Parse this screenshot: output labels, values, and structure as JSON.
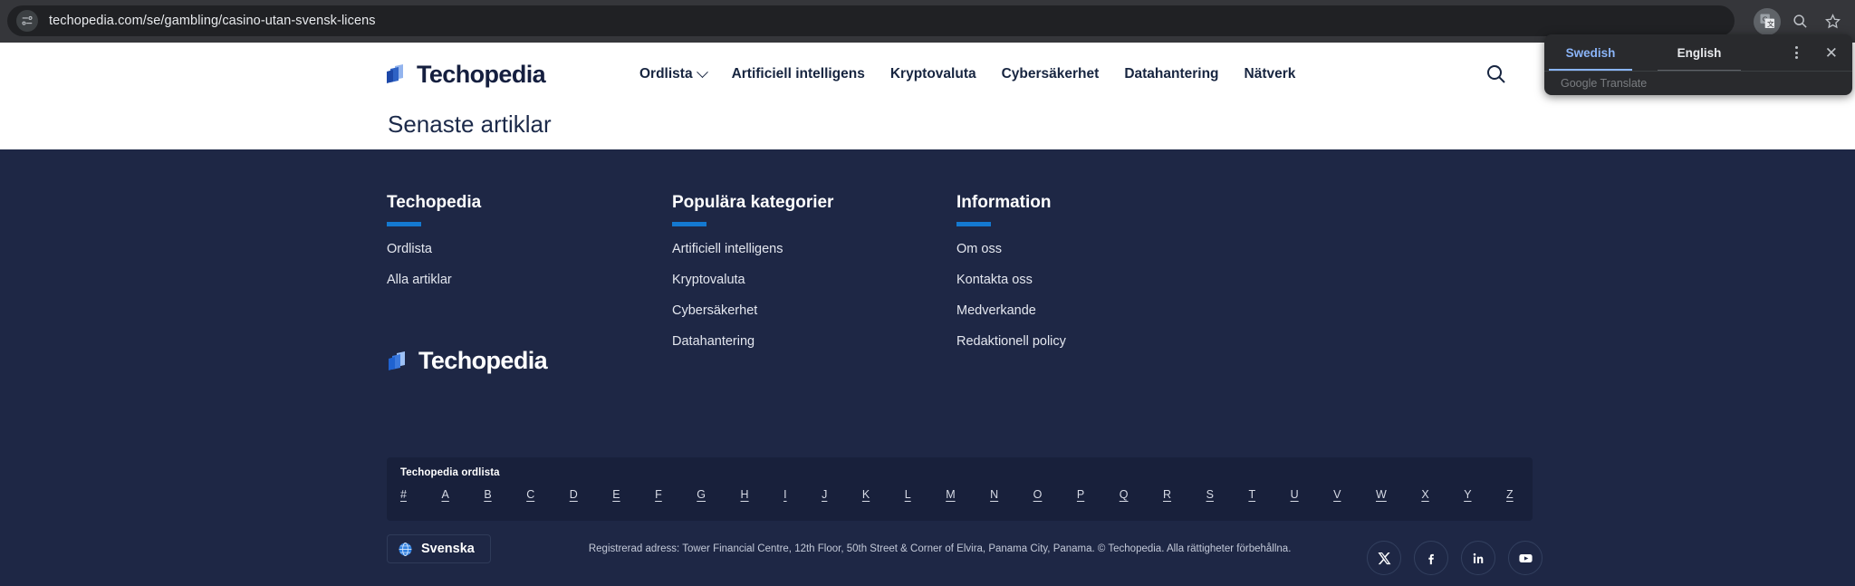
{
  "browser": {
    "url": "techopedia.com/se/gambling/casino-utan-svensk-licens",
    "page_info_icon": "page-settings-icon",
    "translate_icon": "google-translate-icon",
    "search_icon": "search-icon",
    "bookmark_icon": "bookmark-star-icon"
  },
  "translate_popup": {
    "source_lang": "Swedish",
    "target_lang": "English",
    "provider": "Google Translate",
    "menu_icon": "kebab-menu-icon",
    "close_icon": "close-icon",
    "accent": "#8ab4f8"
  },
  "header": {
    "brand": "Techopedia",
    "nav": [
      {
        "label": "Ordlista",
        "has_dropdown": true
      },
      {
        "label": "Artificiell intelligens",
        "has_dropdown": false
      },
      {
        "label": "Kryptovaluta",
        "has_dropdown": false
      },
      {
        "label": "Cybersäkerhet",
        "has_dropdown": false
      },
      {
        "label": "Datahantering",
        "has_dropdown": false
      },
      {
        "label": "Nätverk",
        "has_dropdown": false
      }
    ],
    "search_icon": "search-icon"
  },
  "latest": {
    "title": "Senaste artiklar"
  },
  "footer": {
    "brand": "Techopedia",
    "accent": "#1479d1",
    "background": "#1e2745",
    "columns": [
      {
        "title": "Techopedia",
        "links": [
          "Ordlista",
          "Alla artiklar"
        ]
      },
      {
        "title": "Populära kategorier",
        "links": [
          "Artificiell intelligens",
          "Kryptovaluta",
          "Cybersäkerhet",
          "Datahantering"
        ]
      },
      {
        "title": "Information",
        "links": [
          "Om oss",
          "Kontakta oss",
          "Medverkande",
          "Redaktionell policy"
        ]
      }
    ],
    "social": [
      {
        "name": "x-twitter-icon",
        "glyph": "𝕏"
      },
      {
        "name": "facebook-icon",
        "glyph": "f"
      },
      {
        "name": "linkedin-icon",
        "glyph": "in"
      },
      {
        "name": "youtube-icon",
        "glyph": "▶"
      }
    ],
    "glossary": {
      "label": "Techopedia ordlista",
      "letters": [
        "#",
        "A",
        "B",
        "C",
        "D",
        "E",
        "F",
        "G",
        "H",
        "I",
        "J",
        "K",
        "L",
        "M",
        "N",
        "O",
        "P",
        "Q",
        "R",
        "S",
        "T",
        "U",
        "V",
        "W",
        "X",
        "Y",
        "Z"
      ]
    },
    "language": {
      "label": "Svenska",
      "icon": "globe-icon"
    },
    "legal": "Registrerad adress: Tower Financial Centre, 12th Floor, 50th Street & Corner of Elvira, Panama City, Panama. © Techopedia. Alla rättigheter förbehållna."
  }
}
